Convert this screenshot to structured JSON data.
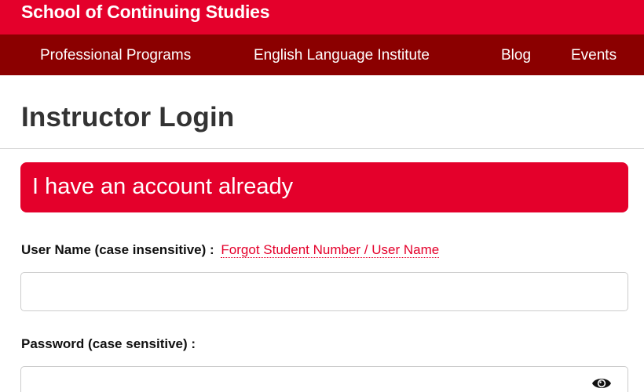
{
  "header": {
    "site_title": "School of Continuing Studies",
    "nav": [
      {
        "label": "Professional Programs"
      },
      {
        "label": "English Language Institute"
      },
      {
        "label": "Blog"
      },
      {
        "label": "Events"
      }
    ]
  },
  "main": {
    "page_title": "Instructor Login",
    "section_banner": "I have an account already",
    "username": {
      "label": "User Name (case insensitive) :",
      "forgot_link": "Forgot Student Number / User Name",
      "value": "",
      "placeholder": ""
    },
    "password": {
      "label": "Password (case sensitive) :",
      "value": "",
      "placeholder": "",
      "toggle_icon": "eye-icon"
    }
  },
  "colors": {
    "brand_red": "#e4002b",
    "nav_dark_red": "#8b0000",
    "text_dark": "#333333"
  }
}
